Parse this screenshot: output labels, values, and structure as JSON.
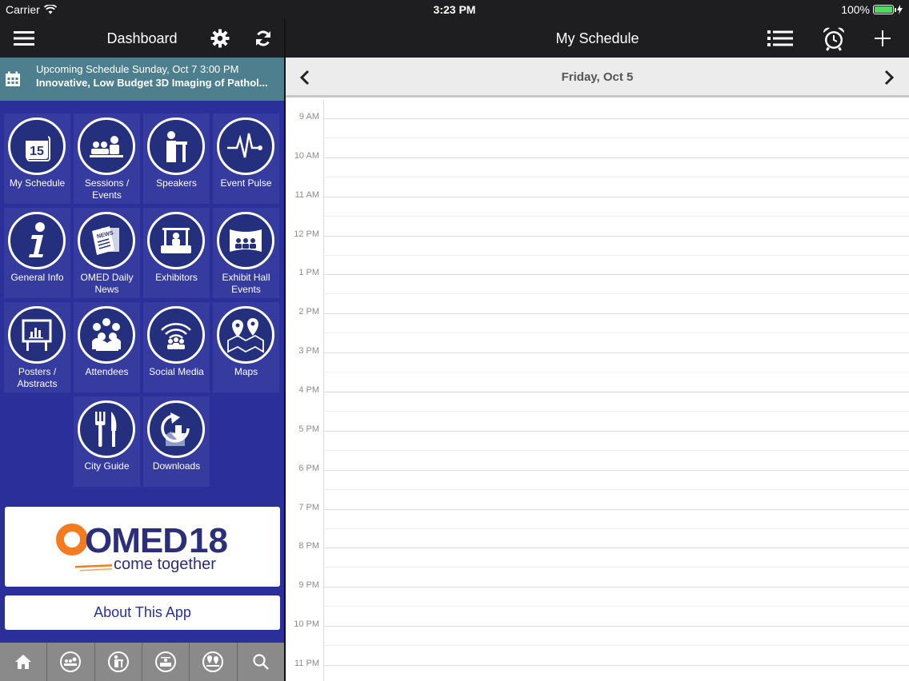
{
  "status_bar": {
    "carrier": "Carrier",
    "time": "3:23 PM",
    "battery": "100%"
  },
  "left_header": {
    "title": "Dashboard"
  },
  "upcoming": {
    "line1": "Upcoming Schedule Sunday, Oct 7 3:00 PM",
    "line2": "Innovative, Low Budget 3D Imaging of Pathol..."
  },
  "tiles": [
    {
      "label": "My Schedule",
      "icon": "calendar-15-icon"
    },
    {
      "label": "Sessions / Events",
      "icon": "audience-icon"
    },
    {
      "label": "Speakers",
      "icon": "speaker-podium-icon"
    },
    {
      "label": "Event Pulse",
      "icon": "pulse-icon"
    },
    {
      "label": "General Info",
      "icon": "info-icon"
    },
    {
      "label": "OMED Daily News",
      "icon": "newspaper-icon"
    },
    {
      "label": "Exhibitors",
      "icon": "booth-icon"
    },
    {
      "label": "Exhibit Hall Events",
      "icon": "exhibit-hall-icon"
    },
    {
      "label": "Posters / Abstracts",
      "icon": "poster-board-icon"
    },
    {
      "label": "Attendees",
      "icon": "people-icon"
    },
    {
      "label": "Social Media",
      "icon": "wifi-people-icon"
    },
    {
      "label": "Maps",
      "icon": "map-pins-icon"
    },
    {
      "label": "City Guide",
      "icon": "fork-knife-icon"
    },
    {
      "label": "Downloads",
      "icon": "download-arrow-icon"
    }
  ],
  "logo": {
    "brand": "OMED",
    "year": "18",
    "tagline": "come together",
    "colors": {
      "navy": "#2b2f7a",
      "orange": "#f47b20"
    }
  },
  "about": {
    "label": "About This App"
  },
  "right_header": {
    "title": "My Schedule"
  },
  "day": {
    "label": "Friday, Oct 5"
  },
  "hours": [
    "9 AM",
    "10 AM",
    "11 AM",
    "12 PM",
    "1 PM",
    "2 PM",
    "3 PM",
    "4 PM",
    "5 PM",
    "6 PM",
    "7 PM",
    "8 PM",
    "9 PM",
    "10 PM",
    "11 PM"
  ],
  "colors": {
    "panel_blue": "#2a2f9a",
    "header_dark": "#1e1e20",
    "banner_teal": "#4e7f8f",
    "tabbar_gray": "#8a8a8a"
  }
}
